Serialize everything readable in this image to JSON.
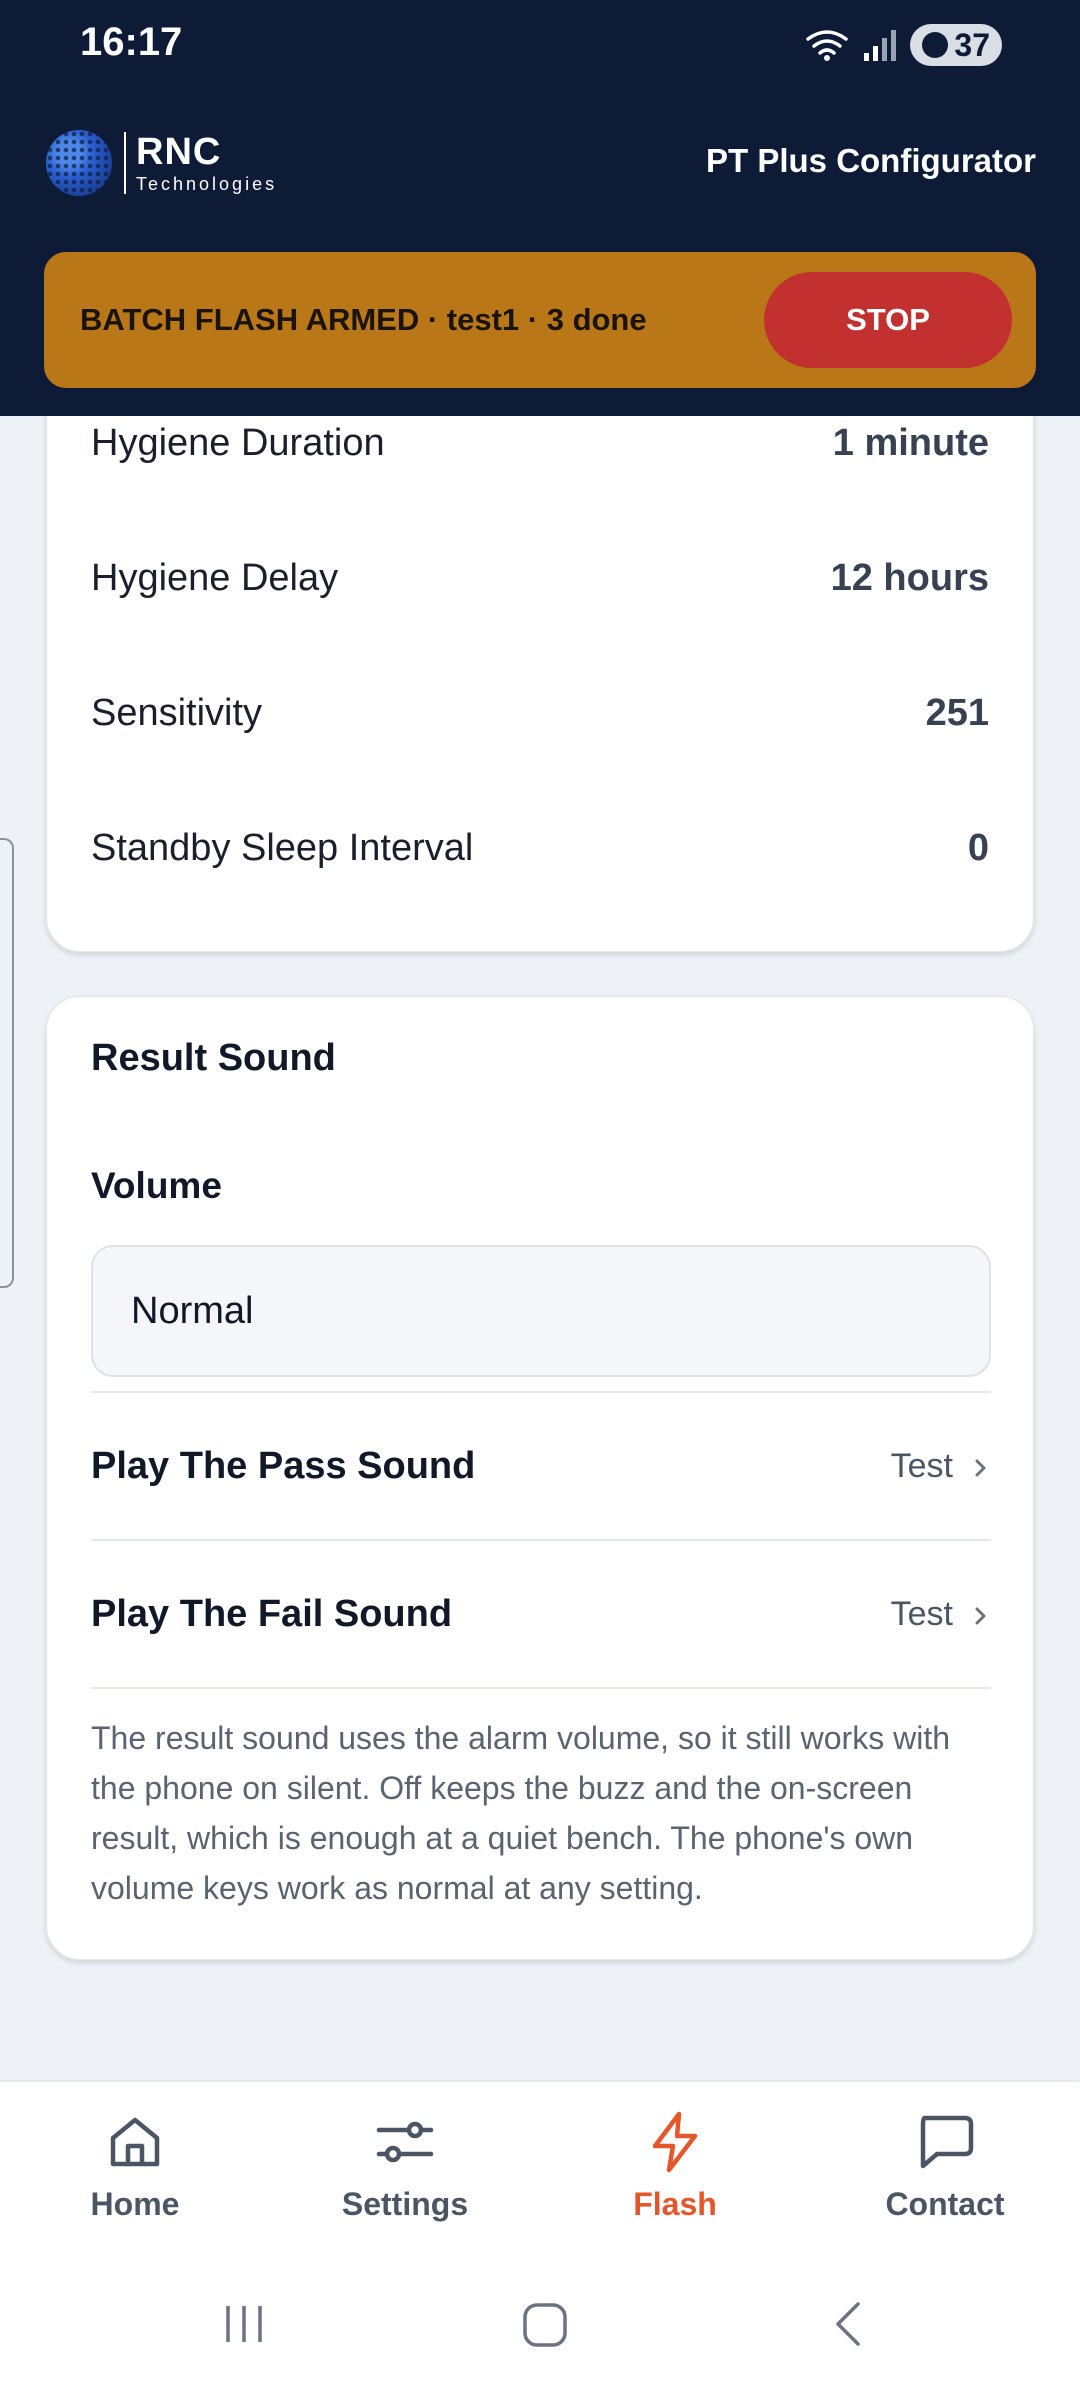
{
  "status_bar": {
    "time": "16:17",
    "battery": "37"
  },
  "header": {
    "logo_main": "RNC",
    "logo_sub": "Technologies",
    "title": "PT Plus Configurator"
  },
  "banner": {
    "text": "BATCH FLASH ARMED · test1 · 3 done",
    "stop_label": "STOP",
    "color": "#b97717",
    "stop_color": "#c2312f"
  },
  "settings": [
    {
      "label": "Hygiene Duration",
      "value": "1 minute"
    },
    {
      "label": "Hygiene Delay",
      "value": "12 hours"
    },
    {
      "label": "Sensitivity",
      "value": "251"
    },
    {
      "label": "Standby Sleep Interval",
      "value": "0"
    }
  ],
  "result_sound": {
    "title": "Result Sound",
    "volume_label": "Volume",
    "volume_value": "Normal",
    "rows": [
      {
        "label": "Play The Pass Sound",
        "action": "Test"
      },
      {
        "label": "Play The Fail Sound",
        "action": "Test"
      }
    ],
    "note": "The result sound uses the alarm volume, so it still works with the phone on silent. Off keeps the buzz and the on-screen result, which is enough at a quiet bench. The phone's own volume keys work as normal at any setting."
  },
  "nav": {
    "items": [
      {
        "label": "Home",
        "icon": "home-icon"
      },
      {
        "label": "Settings",
        "icon": "sliders-icon"
      },
      {
        "label": "Flash",
        "icon": "lightning-icon"
      },
      {
        "label": "Contact",
        "icon": "chat-bubble-icon"
      }
    ],
    "active": "Flash",
    "active_color": "#e4572a"
  }
}
